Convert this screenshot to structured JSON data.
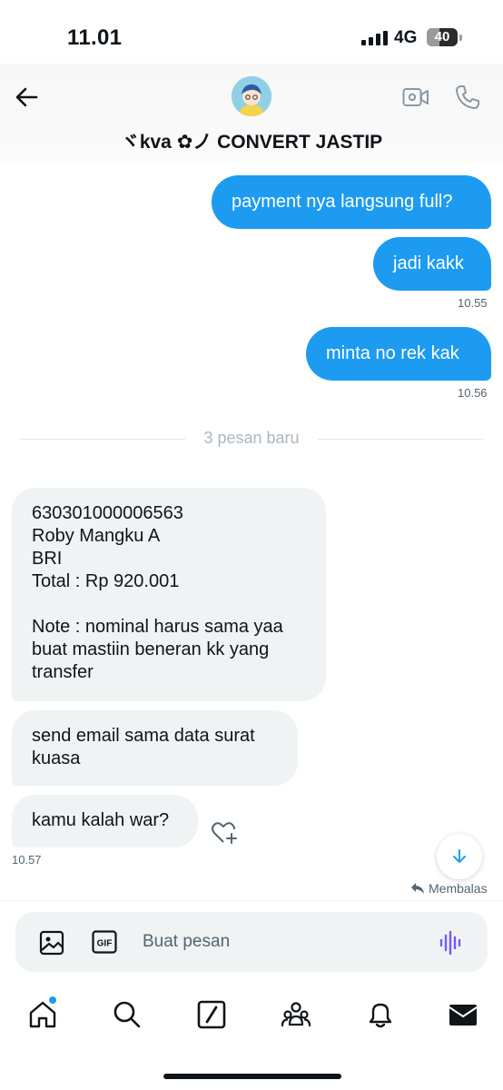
{
  "status_bar": {
    "time": "11.01",
    "network": "4G",
    "battery": "40",
    "battery_level_percent": 40
  },
  "header": {
    "title": "ヾkva ✿ノ CONVERT JASTIP"
  },
  "messages": [
    {
      "text": "payment nya langsung full?"
    },
    {
      "text": "jadi kakk",
      "time": "10.55"
    },
    {
      "text": "minta no rek kak",
      "time": "10.56"
    },
    {
      "text": "630301000006563\nRoby Mangku A\nBRI\nTotal : Rp 920.001\n\nNote : nominal harus sama yaa\nbuat mastiin beneran kk yang\ntransfer"
    },
    {
      "text": "send email sama data surat\nkuasa"
    },
    {
      "text": "kamu kalah war?",
      "time": "10.57"
    }
  ],
  "divider": {
    "text": "3 pesan baru"
  },
  "reply_hint": "Membalas",
  "composer": {
    "placeholder": "Buat pesan",
    "value": ""
  },
  "colors": {
    "accent": "#1d9bf0",
    "incoming_bubble": "#eff3f4",
    "voice_icon": "#7856ff"
  }
}
